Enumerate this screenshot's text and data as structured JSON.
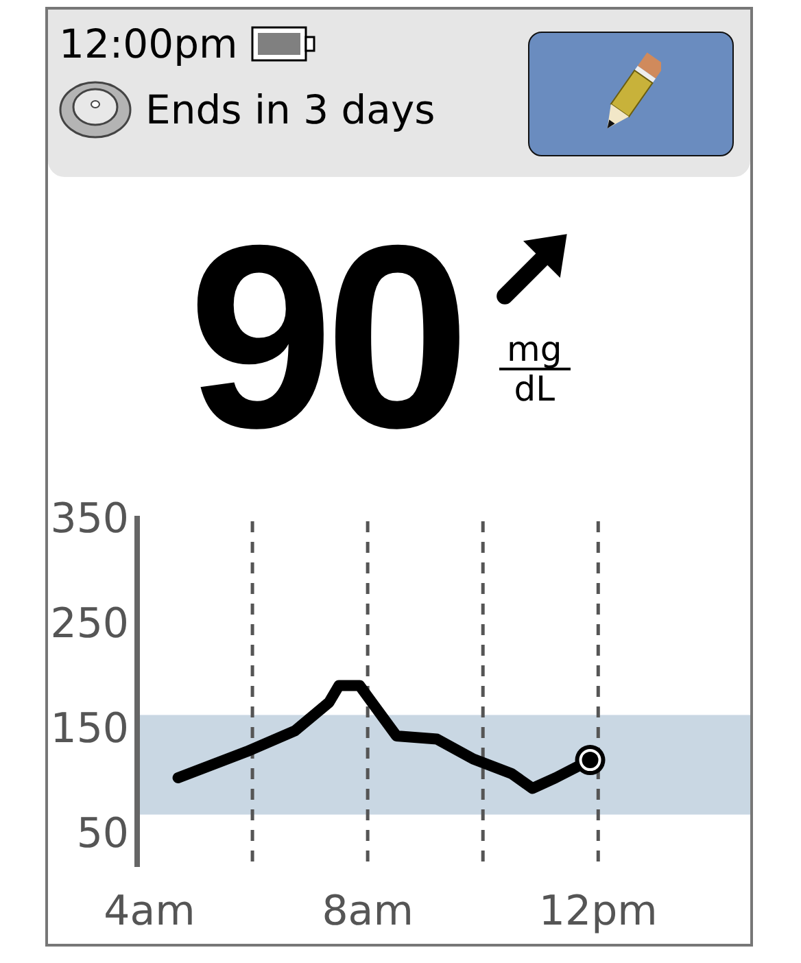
{
  "status": {
    "time": "12:00pm",
    "sensor_text": "Ends in 3 days"
  },
  "reading": {
    "value": "90",
    "unit_top": "mg",
    "unit_bottom": "dL",
    "trend_arrow": {
      "kind": "up_right"
    }
  },
  "chart": {
    "chart_data": {
      "type": "line",
      "x": [
        4.71,
        5.9,
        6.74,
        7.33,
        7.5,
        7.86,
        8.5,
        9.2,
        9.83,
        10.5,
        10.86,
        11.26,
        11.86
      ],
      "series": [
        {
          "color": "#000000",
          "values": [
            100,
            125,
            145,
            172,
            188,
            188,
            140,
            137,
            118,
            104,
            90,
            100,
            117
          ]
        }
      ],
      "xlim": [
        4,
        12
      ],
      "ylim": [
        15,
        350
      ],
      "xticks": [
        {
          "value": 4,
          "label": "4am"
        },
        {
          "value": 8,
          "label": "8am"
        },
        {
          "value": 12,
          "label": "12pm"
        }
      ],
      "yticks": [
        350,
        250,
        150,
        50
      ],
      "bands": [
        {
          "axis": "y",
          "from": 65,
          "to": 160
        }
      ]
    }
  }
}
